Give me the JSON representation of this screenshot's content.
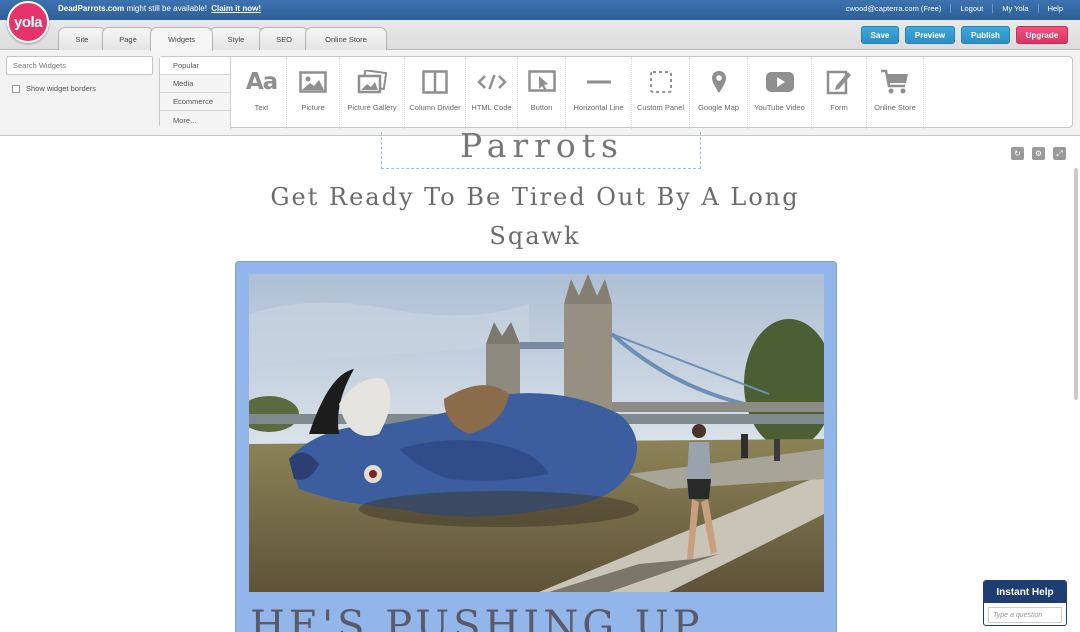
{
  "banner": {
    "domain": "DeadParrots.com",
    "message": " might still be available!",
    "claim_link": "Claim it now!",
    "account": "cwood@capterra.com (Free)",
    "links": [
      "Logout",
      "My Yola",
      "Help"
    ]
  },
  "logo": {
    "text": "yola",
    "color": "#e8336a"
  },
  "tabs": [
    "Site",
    "Page",
    "Widgets",
    "Style",
    "SEO",
    "Online Store"
  ],
  "active_tab": "Widgets",
  "actions": {
    "save": "Save",
    "preview": "Preview",
    "publish": "Publish",
    "upgrade": "Upgrade"
  },
  "widgets_panel": {
    "search_placeholder": "Search Widgets",
    "show_borders_label": "Show widget borders",
    "categories": [
      "Popular",
      "Media",
      "Ecommerce",
      "More..."
    ],
    "active_category": "Popular",
    "widgets": [
      {
        "label": "Text",
        "icon": "text-icon"
      },
      {
        "label": "Picture",
        "icon": "picture-icon"
      },
      {
        "label": "Picture Gallery",
        "icon": "gallery-icon"
      },
      {
        "label": "Column Divider",
        "icon": "column-divider-icon"
      },
      {
        "label": "HTML Code",
        "icon": "code-icon"
      },
      {
        "label": "Button",
        "icon": "cursor-icon"
      },
      {
        "label": "Horizontal Line",
        "icon": "horizontal-line-icon"
      },
      {
        "label": "Custom Panel",
        "icon": "dashed-box-icon"
      },
      {
        "label": "Google Map",
        "icon": "map-pin-icon"
      },
      {
        "label": "YouTube Video",
        "icon": "play-icon"
      },
      {
        "label": "Form",
        "icon": "form-edit-icon"
      },
      {
        "label": "Online Store",
        "icon": "cart-icon"
      }
    ]
  },
  "page": {
    "site_title": "Parrots Galore",
    "headline": "Get Ready To Be Tired Out By A Long Sqawk",
    "caption": "HE'S PUSHING UP"
  },
  "help": {
    "title": "Instant Help",
    "placeholder": "Type a question"
  },
  "colors": {
    "top_banner": "#2e5f98",
    "button_blue": "#2b8ec4",
    "button_pink": "#db3565",
    "photo_frame": "#93b6ea",
    "help_header": "#1d3d73"
  }
}
